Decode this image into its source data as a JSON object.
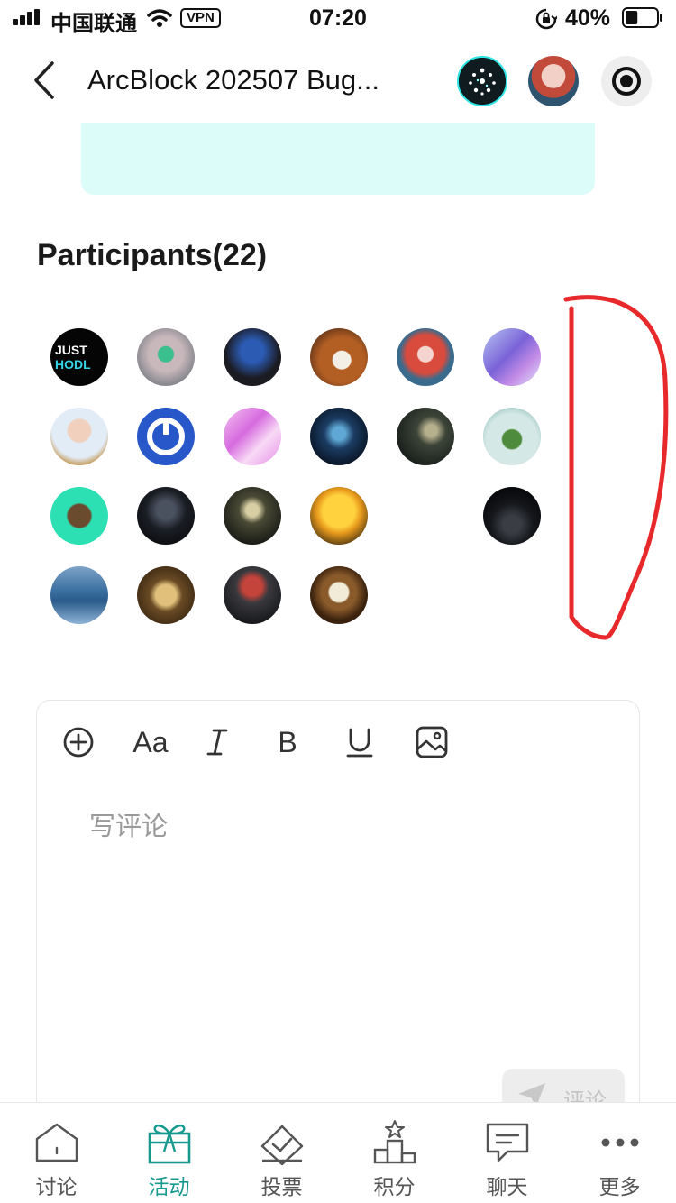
{
  "status_bar": {
    "carrier": "中国联通",
    "vpn": "VPN",
    "time": "07:20",
    "battery_percent": "40%",
    "battery_level": 0.4
  },
  "header": {
    "title": "ArcBlock 202507 Bug...",
    "icons": [
      "back-chevron-icon",
      "dapp-avatar",
      "user-avatar",
      "record-icon"
    ]
  },
  "participants": {
    "title": "Participants(22)",
    "count": 22
  },
  "editor": {
    "placeholder": "写评论",
    "submit_label": "评论",
    "toolbar": {
      "bold": "B",
      "text_size": "Aa"
    }
  },
  "bottom_nav": {
    "items": [
      {
        "label": "讨论",
        "icon": "house-icon"
      },
      {
        "label": "活动",
        "icon": "gift-icon",
        "active": true
      },
      {
        "label": "投票",
        "icon": "ballot-box-icon"
      },
      {
        "label": "积分",
        "icon": "podium-icon"
      },
      {
        "label": "聊天",
        "icon": "chat-icon"
      },
      {
        "label": "更多",
        "icon": "more-dots-icon"
      }
    ]
  },
  "colors": {
    "accent": "#18998e",
    "card_bg": "#dcfcfa",
    "annotation": "#e8292b"
  }
}
